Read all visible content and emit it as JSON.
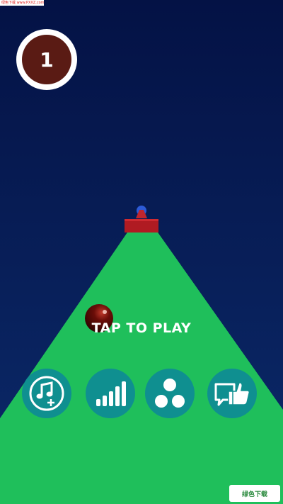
{
  "game": {
    "level": "1",
    "prompt": "TAP TO PLAY"
  },
  "buttons": [
    {
      "name": "music-add-button",
      "icon": "music-note-plus-icon"
    },
    {
      "name": "leaderboard-button",
      "icon": "signal-bars-icon"
    },
    {
      "name": "share-button",
      "icon": "three-dots-cluster-icon"
    },
    {
      "name": "feedback-button",
      "icon": "thumbs-up-speech-icon"
    }
  ],
  "watermarks": {
    "top": "绿色下载 www.PXXZ.com",
    "bottom": "绿色下载"
  },
  "colors": {
    "sky": "#081e55",
    "road": "#1fbf5b",
    "level_badge": "#5a1b14",
    "button": "#0f8f90",
    "block": "#b01b22",
    "ball": "#6a0d08"
  }
}
